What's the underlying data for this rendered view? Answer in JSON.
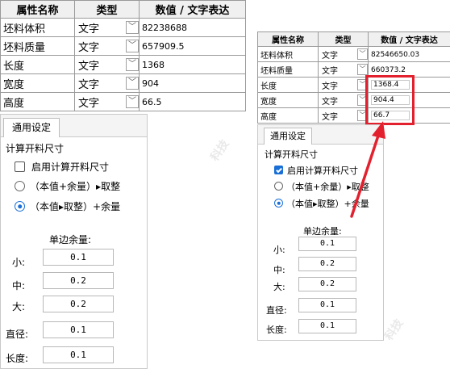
{
  "left_table": {
    "headers": [
      "属性名称",
      "类型",
      "数值 / 文字表达"
    ],
    "rows": [
      {
        "name": "坯料体积",
        "type": "文字",
        "value": "82238688"
      },
      {
        "name": "坯料质量",
        "type": "文字",
        "value": "657909.5"
      },
      {
        "name": "长度",
        "type": "文字",
        "value": "1368"
      },
      {
        "name": "宽度",
        "type": "文字",
        "value": "904"
      },
      {
        "name": "高度",
        "type": "文字",
        "value": "66.5"
      }
    ]
  },
  "right_table": {
    "headers": [
      "属性名称",
      "类型",
      "数值 / 文字表达"
    ],
    "rows": [
      {
        "name": "坯料体积",
        "type": "文字",
        "value": "82546650.03"
      },
      {
        "name": "坯料质量",
        "type": "文字",
        "value": "660373.2"
      },
      {
        "name": "长度",
        "type": "文字",
        "value": "1368.4"
      },
      {
        "name": "宽度",
        "type": "文字",
        "value": "904.4"
      },
      {
        "name": "高度",
        "type": "文字",
        "value": "66.7"
      }
    ]
  },
  "left_panel": {
    "tab": "通用设定",
    "section": "计算开料尺寸",
    "checkbox_label": "启用计算开料尺寸",
    "checkbox_checked": false,
    "radio1": "（本值+余量）▸取整",
    "radio2": "（本值▸取整）+余量",
    "selected_radio": 2,
    "margin_title": "单边余量:",
    "small_label": "小:",
    "small_value": "0.1",
    "mid_label": "中:",
    "mid_value": "0.2",
    "big_label": "大:",
    "big_value": "0.2",
    "diameter_label": "直径:",
    "diameter_value": "0.1",
    "length_label": "长度:",
    "length_value": "0.1"
  },
  "right_panel": {
    "tab": "通用设定",
    "section": "计算开料尺寸",
    "checkbox_label": "启用计算开料尺寸",
    "checkbox_checked": true,
    "radio1": "（本值+余量）▸取整",
    "radio2": "（本值▸取整）+余量",
    "selected_radio": 2,
    "margin_title": "单边余量:",
    "small_label": "小:",
    "small_value": "0.1",
    "mid_label": "中:",
    "mid_value": "0.2",
    "big_label": "大:",
    "big_value": "0.2",
    "diameter_label": "直径:",
    "diameter_value": "0.1",
    "length_label": "长度:",
    "length_value": "0.1"
  },
  "colors": {
    "highlight": "#e3202e",
    "accent": "#1a6fd6"
  },
  "icons": {
    "dropdown": "chevron-down-icon",
    "arrow": "red-arrow-icon"
  }
}
